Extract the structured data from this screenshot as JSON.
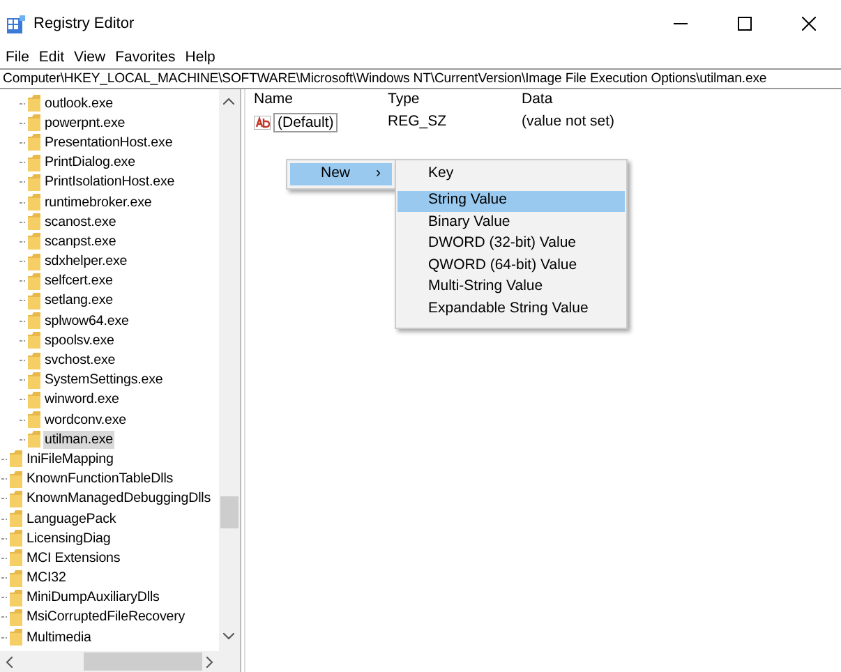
{
  "window": {
    "title": "Registry Editor"
  },
  "menu_bar": [
    "File",
    "Edit",
    "View",
    "Favorites",
    "Help"
  ],
  "address_bar": "Computer\\HKEY_LOCAL_MACHINE\\SOFTWARE\\Microsoft\\Windows NT\\CurrentVersion\\Image File Execution Options\\utilman.exe",
  "tree": {
    "items": [
      {
        "children": [
          {
            "label": "outlook.exe",
            "selected": false
          },
          {
            "label": "powerpnt.exe",
            "selected": false
          },
          {
            "label": "PresentationHost.exe",
            "selected": false
          },
          {
            "label": "PrintDialog.exe",
            "selected": false
          },
          {
            "label": "PrintIsolationHost.exe",
            "selected": false
          },
          {
            "label": "runtimebroker.exe",
            "selected": false
          },
          {
            "label": "scanost.exe",
            "selected": false
          },
          {
            "label": "scanpst.exe",
            "selected": false
          },
          {
            "label": "sdxhelper.exe",
            "selected": false
          },
          {
            "label": "selfcert.exe",
            "selected": false
          },
          {
            "label": "setlang.exe",
            "selected": false
          },
          {
            "label": "splwow64.exe",
            "selected": false
          },
          {
            "label": "spoolsv.exe",
            "selected": false
          },
          {
            "label": "svchost.exe",
            "selected": false
          },
          {
            "label": "SystemSettings.exe",
            "selected": false
          },
          {
            "label": "winword.exe",
            "selected": false
          },
          {
            "label": "wordconv.exe",
            "selected": false
          },
          {
            "label": "utilman.exe",
            "selected": true
          }
        ]
      },
      {
        "label": "IniFileMapping",
        "selected": false
      },
      {
        "label": "KnownFunctionTableDlls",
        "selected": false
      },
      {
        "label": "KnownManagedDebuggingDlls",
        "selected": false
      },
      {
        "label": "LanguagePack",
        "selected": false
      },
      {
        "label": "LicensingDiag",
        "selected": false
      },
      {
        "label": "MCI Extensions",
        "selected": false
      },
      {
        "label": "MCI32",
        "selected": false
      },
      {
        "label": "MiniDumpAuxiliaryDlls",
        "selected": false
      },
      {
        "label": "MsiCorruptedFileRecovery",
        "selected": false
      },
      {
        "label": "Multimedia",
        "selected": false
      }
    ]
  },
  "values": {
    "columns": [
      "Name",
      "Type",
      "Data"
    ],
    "rows": [
      {
        "name": "(Default)",
        "type": "REG_SZ",
        "data": "(value not set)"
      }
    ]
  },
  "context_menu": {
    "items": [
      {
        "label": "New",
        "selected": true,
        "arrow": "›"
      }
    ]
  },
  "submenu": {
    "items": [
      {
        "label": "Key",
        "selected": false
      },
      {
        "label": "String Value",
        "selected": true
      },
      {
        "label": "Binary Value",
        "selected": false
      },
      {
        "label": "DWORD (32-bit) Value",
        "selected": false
      },
      {
        "label": "QWORD (64-bit) Value",
        "selected": false
      },
      {
        "label": "Multi-String Value",
        "selected": false
      },
      {
        "label": "Expandable String Value",
        "selected": false
      }
    ]
  }
}
